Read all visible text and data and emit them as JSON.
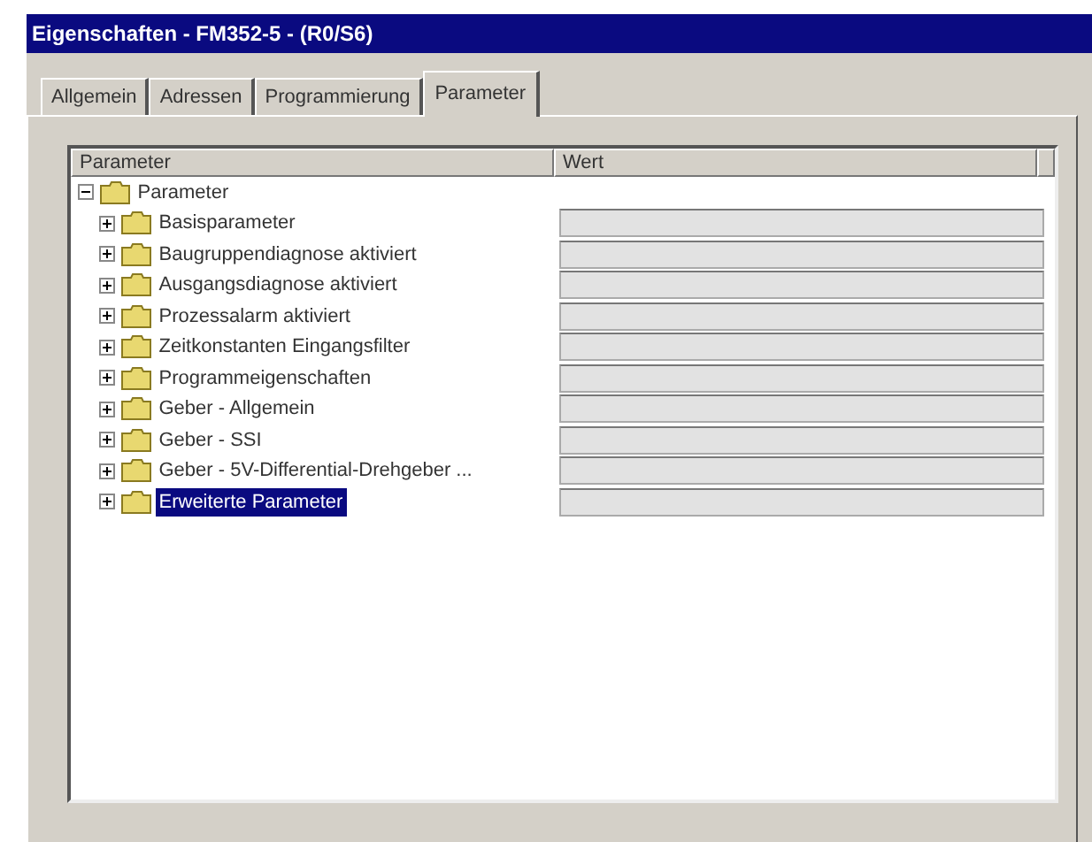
{
  "window": {
    "title": "Eigenschaften - FM352-5 - (R0/S6)"
  },
  "tabs": [
    {
      "label": "Allgemein",
      "selected": false
    },
    {
      "label": "Adressen",
      "selected": false
    },
    {
      "label": "Programmierung",
      "selected": false
    },
    {
      "label": "Parameter",
      "selected": true
    }
  ],
  "table": {
    "columns": [
      "Parameter",
      "Wert"
    ],
    "tree": {
      "label": "Parameter",
      "expanded": true,
      "selected": false,
      "children": [
        {
          "label": "Basisparameter",
          "expanded": false,
          "selected": false
        },
        {
          "label": "Baugruppendiagnose aktiviert",
          "expanded": false,
          "selected": false
        },
        {
          "label": "Ausgangsdiagnose aktiviert",
          "expanded": false,
          "selected": false
        },
        {
          "label": "Prozessalarm aktiviert",
          "expanded": false,
          "selected": false
        },
        {
          "label": "Zeitkonstanten Eingangsfilter",
          "expanded": false,
          "selected": false
        },
        {
          "label": "Programmeigenschaften",
          "expanded": false,
          "selected": false
        },
        {
          "label": "Geber - Allgemein",
          "expanded": false,
          "selected": false
        },
        {
          "label": "Geber - SSI",
          "expanded": false,
          "selected": false
        },
        {
          "label": "Geber - 5V-Differential-Drehgeber ...",
          "expanded": false,
          "selected": false
        },
        {
          "label": "Erweiterte Parameter",
          "expanded": false,
          "selected": true
        }
      ]
    }
  }
}
